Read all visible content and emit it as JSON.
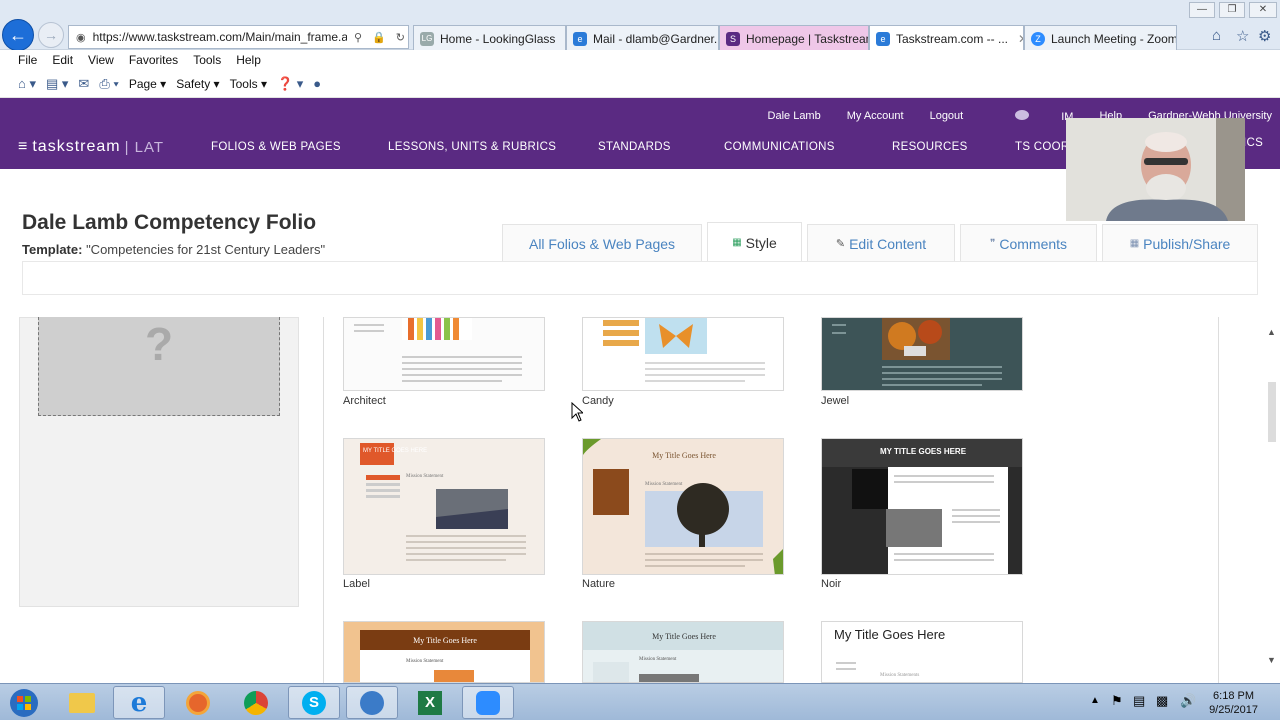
{
  "browser": {
    "url": "https://www.taskstream.com/Main/main_frame.as",
    "tabs": [
      {
        "label": "Home - LookingGlass",
        "icon": "LG"
      },
      {
        "label": "Mail - dlamb@Gardner...",
        "icon": "e"
      },
      {
        "label": "Homepage | Taskstream",
        "icon": "S"
      },
      {
        "label": "Taskstream.com -- ...",
        "icon": "e"
      },
      {
        "label": "Launch Meeting - Zoom",
        "icon": "Z"
      }
    ],
    "menu": [
      "File",
      "Edit",
      "View",
      "Favorites",
      "Tools",
      "Help"
    ],
    "commands": [
      "Page ▾",
      "Safety ▾",
      "Tools ▾"
    ]
  },
  "header": {
    "user": "Dale Lamb",
    "my_account": "My Account",
    "logout": "Logout",
    "im": "IM",
    "help": "Help",
    "org": "Gardner-Webb University",
    "logo": "tasksream",
    "logo_text": "taskstream",
    "logo_suffix": "| LAT",
    "nav": [
      "FOLIOS & WEB PAGES",
      "LESSONS, UNITS & RUBRICS",
      "STANDARDS",
      "COMMUNICATIONS",
      "RESOURCES",
      "TS COOR",
      "ICS"
    ]
  },
  "folio": {
    "title": "Dale Lamb Competency Folio",
    "template_label": "Template:",
    "template_name": "\"Competencies for 21st Century Leaders\"",
    "tabs": [
      "All Folios & Web Pages",
      "Style",
      "Edit Content",
      "Comments",
      "Publish/Share"
    ]
  },
  "styles": [
    {
      "name": "Architect"
    },
    {
      "name": "Candy"
    },
    {
      "name": "Jewel"
    },
    {
      "name": "Label",
      "title": "MY TITLE GOES HERE",
      "mission": "Mission Statement"
    },
    {
      "name": "Nature",
      "title": "My Title Goes Here",
      "mission": "Mission Statement"
    },
    {
      "name": "Noir",
      "title": "MY TITLE GOES HERE"
    },
    {
      "name": "",
      "title": "My Title Goes Here",
      "mission": "Mission Statement"
    },
    {
      "name": "",
      "title": "My Title Goes Here",
      "mission": "Mission Statement"
    },
    {
      "name": "",
      "title": "My Title Goes Here",
      "mission": "Mission Statements"
    }
  ],
  "taskbar": {
    "time": "6:18 PM",
    "date": "9/25/2017"
  },
  "colors": {
    "brand": "#5a2a82",
    "link": "#4a84c0"
  }
}
